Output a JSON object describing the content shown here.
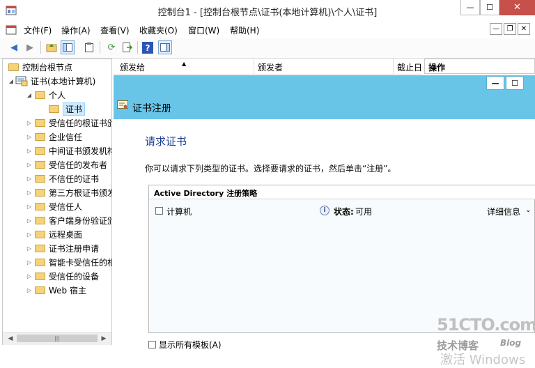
{
  "window": {
    "title": "控制台1 - [控制台根节点\\证书(本地计算机)\\个人\\证书]",
    "min_glyph": "—",
    "max_glyph": "☐",
    "close_glyph": "✕"
  },
  "menubar": {
    "items": [
      "文件(F)",
      "操作(A)",
      "查看(V)",
      "收藏夹(O)",
      "窗口(W)",
      "帮助(H)"
    ],
    "mdi_min": "—",
    "mdi_restore": "❐",
    "mdi_close": "✕"
  },
  "toolbar": {
    "icons": [
      "back-arrow-icon",
      "forward-arrow-icon",
      "up-folder-icon",
      "show-tree-icon",
      "properties-icon",
      "refresh-icon",
      "export-list-icon",
      "help-icon",
      "show-action-pane-icon"
    ]
  },
  "tree": {
    "root": "控制台根节点",
    "store": "证书(本地计算机)",
    "personal": "个人",
    "certs": "证书",
    "folders": [
      "受信任的根证书颁",
      "企业信任",
      "中间证书颁发机构",
      "受信任的发布者",
      "不信任的证书",
      "第三方根证书颁发",
      "受信任人",
      "客户端身份验证颁",
      "远程桌面",
      "证书注册申请",
      "智能卡受信任的根",
      "受信任的设备",
      "Web 宿主"
    ]
  },
  "list": {
    "col_issued_to": "颁发给",
    "col_issued_by": "颁发者",
    "col_expiry": "截止日",
    "actions": "操作"
  },
  "dialog": {
    "min_glyph": "—",
    "max_glyph": "☐",
    "header": "证书注册",
    "heading": "请求证书",
    "description": "你可以请求下列类型的证书。选择要请求的证书，然后单击“注册”。",
    "policy_title": "Active Directory 注册策略",
    "template_name": "计算机",
    "status_label": "状态:",
    "status_value": "可用",
    "details": "详细信息",
    "show_all": "显示所有模板(A)"
  },
  "watermark": {
    "line1": "51CTO.com",
    "line2": "技术博客",
    "line2b": "Blog",
    "line3": "激活 Windows"
  },
  "colors": {
    "dialog_header": "#68c5e8",
    "close_button": "#c7504b",
    "heading_text": "#1c3f95"
  }
}
